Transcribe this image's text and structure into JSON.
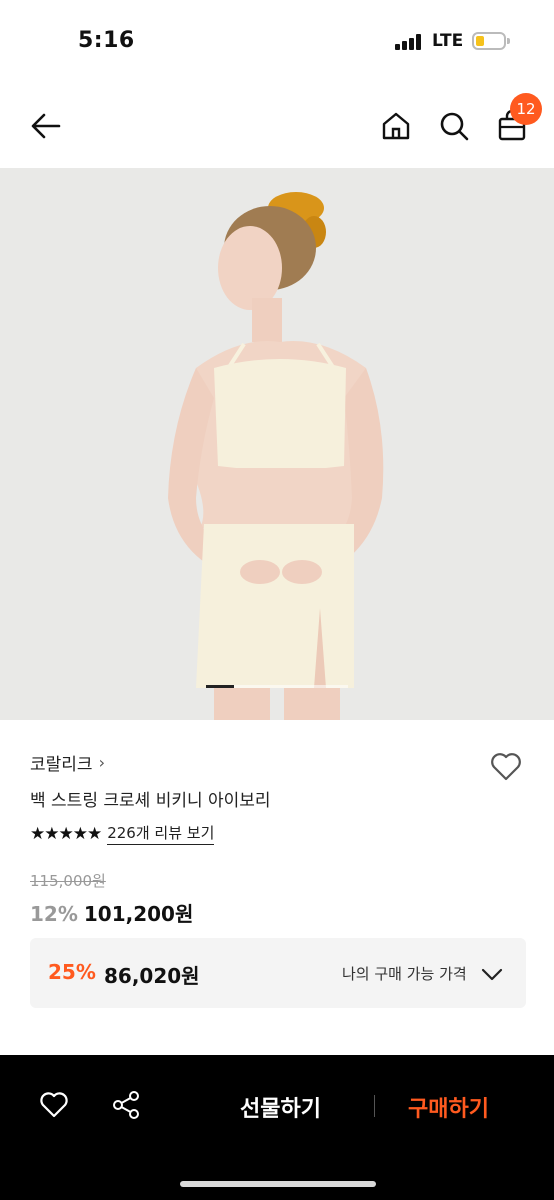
{
  "status_bar": {
    "time": "5:16",
    "network": "LTE",
    "battery_color": "#f6c21c"
  },
  "header": {
    "back_icon": "arrow-left-icon",
    "home_icon": "home-icon",
    "search_icon": "search-icon",
    "bag_icon": "shopping-bag-icon",
    "cart_count": "12",
    "badge_color": "#ff5a1f"
  },
  "product": {
    "image_alt_icon": "product-photo",
    "image_count_indicator": "1",
    "brand": "코랄리크",
    "brand_chevron": "›",
    "title": "백 스트링 크로셰 비키니 아이보리",
    "rating_stars": "★★★★★",
    "rating_value": 5,
    "review_link": "226개 리뷰 보기",
    "original_price": "115,000원",
    "discount_rate": "12%",
    "sale_price": "101,200원",
    "my_price": {
      "discount_rate": "25%",
      "price": "86,020원",
      "label": "나의 구매 가능 가격"
    }
  },
  "bottom_bar": {
    "like_icon": "heart-icon",
    "share_icon": "share-icon",
    "gift_label": "선물하기",
    "buy_label": "구매하기",
    "accent_color": "#ff5a1f"
  }
}
